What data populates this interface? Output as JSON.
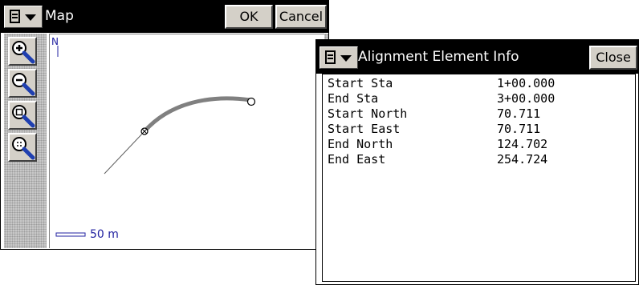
{
  "map_window": {
    "title": "Map",
    "ok_label": "OK",
    "cancel_label": "Cancel",
    "north_label": "N",
    "scale_label": "50 m",
    "zoom_tools": [
      {
        "icon": "zoom-in-icon"
      },
      {
        "icon": "zoom-out-icon"
      },
      {
        "icon": "zoom-window-icon"
      },
      {
        "icon": "zoom-extents-icon"
      }
    ]
  },
  "info_window": {
    "title": "Alignment Element Info",
    "close_label": "Close",
    "rows": [
      {
        "label": "Start Sta",
        "value": "1+00.000"
      },
      {
        "label": "End Sta",
        "value": "3+00.000"
      },
      {
        "label": "Start North",
        "value": "70.711"
      },
      {
        "label": "Start East",
        "value": "70.711"
      },
      {
        "label": "End North",
        "value": "124.702"
      },
      {
        "label": "End East",
        "value": "254.724"
      }
    ]
  },
  "colors": {
    "titlebar": "#000000",
    "title_text": "#ffffff",
    "button_face": "#d4d0c8",
    "map_accent": "#2020a0",
    "curve": "#808080"
  }
}
